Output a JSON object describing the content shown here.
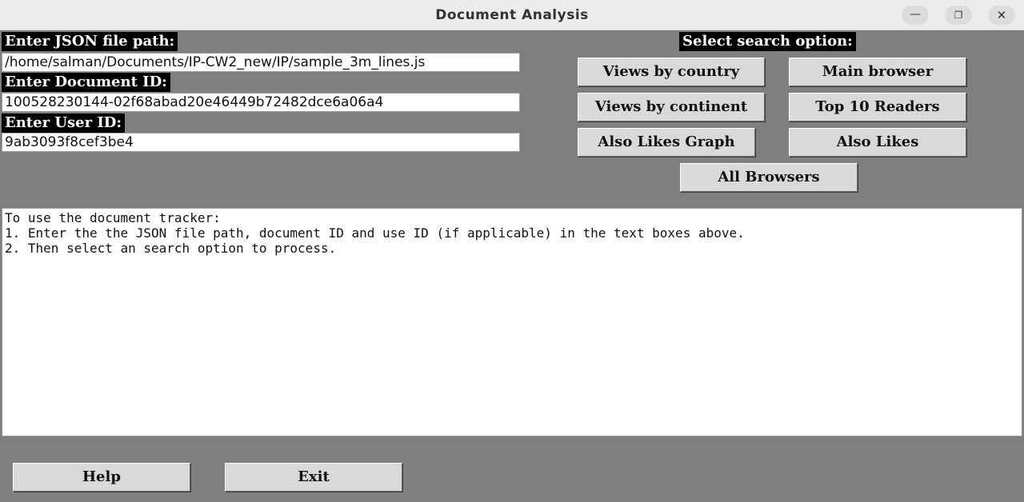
{
  "window": {
    "title": "Document Analysis",
    "minimize_glyph": "—",
    "maximize_glyph": "❐",
    "close_glyph": "✕"
  },
  "form": {
    "json_path_label": "Enter JSON file path:",
    "json_path_value": "/home/salman/Documents/IP-CW2_new/IP/sample_3m_lines.js",
    "doc_id_label": "Enter Document ID:",
    "doc_id_value": "100528230144-02f68abad20e46449b72482dce6a06a4",
    "user_id_label": "Enter User ID:",
    "user_id_value": "9ab3093f8cef3be4"
  },
  "search": {
    "label": "Select search option:",
    "views_by_country": "Views by country",
    "main_browser": "Main browser",
    "views_by_continent": "Views by continent",
    "top_10_readers": "Top 10 Readers",
    "also_likes_graph": "Also Likes Graph",
    "also_likes": "Also Likes",
    "all_browsers": "All Browsers"
  },
  "output": {
    "lines": [
      "To use the document tracker:",
      "1. Enter the the JSON file path, document ID and use ID (if applicable) in the text boxes above.",
      "2. Then select an search option to process."
    ]
  },
  "footer": {
    "help": "Help",
    "exit": "Exit"
  }
}
